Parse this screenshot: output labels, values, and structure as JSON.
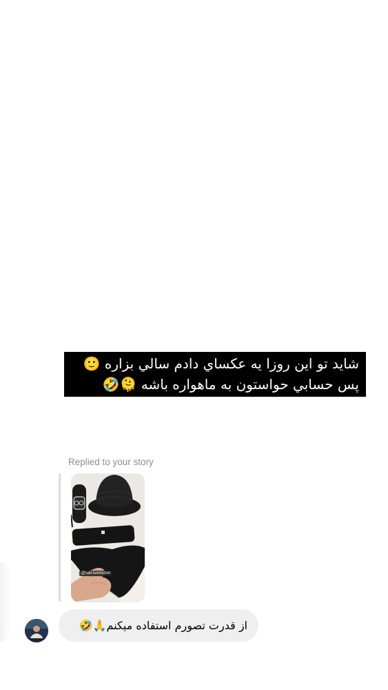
{
  "story_caption": {
    "line1": "شايد تو اين روزا يه عكساي دادم سالي بزاره 🙂",
    "line2": "پس حسابي حواستون به ماهواره باشه 🫠🤣"
  },
  "reply": {
    "label": "Replied to your story",
    "story_tag": "@sali.luxmezon"
  },
  "message": {
    "text": "از قدرت تصورم استفاده ميكنم🙏🤣"
  }
}
